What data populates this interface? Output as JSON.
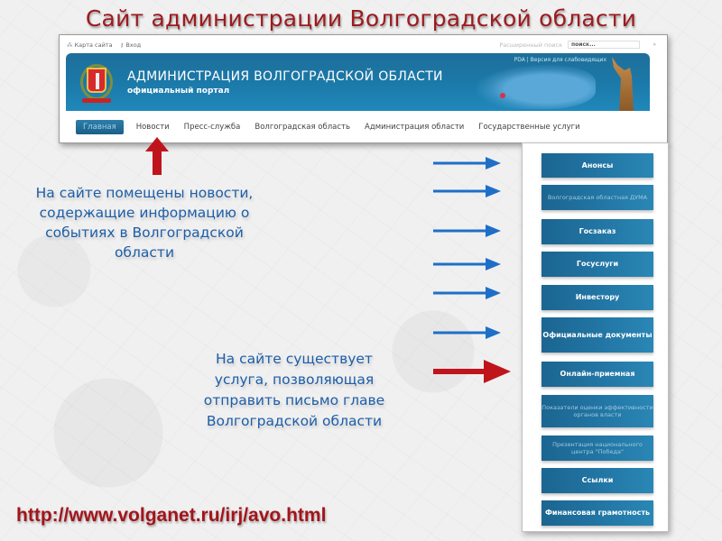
{
  "slide": {
    "title": "Сайт администрации Волгоградской области",
    "url": "http://www.volganet.ru/irj/avo.html"
  },
  "website": {
    "topbar": {
      "sitemap_link": "Карта сайта",
      "login_link": "Вход",
      "search_label": "Расширенный поиск",
      "search_placeholder": "поиск...",
      "search_go": "»"
    },
    "banner": {
      "title": "АДМИНИСТРАЦИЯ ВОЛГОГРАДСКОЙ ОБЛАСТИ",
      "subtitle": "официальный портал",
      "links": "PDA | Версия для слабовидящих"
    },
    "nav": [
      {
        "label": "Главная",
        "active": true
      },
      {
        "label": "Новости",
        "active": false
      },
      {
        "label": "Пресс-служба",
        "active": false
      },
      {
        "label": "Волгоградская область",
        "active": false
      },
      {
        "label": "Администрация области",
        "active": false
      },
      {
        "label": "Государственные услуги",
        "active": false
      }
    ]
  },
  "sidebar": {
    "buttons": [
      {
        "label": "Анонсы"
      },
      {
        "label": "Волгоградская областная ДУМА"
      },
      {
        "label": "Госзаказ"
      },
      {
        "label": "Госуслуги"
      },
      {
        "label": "Инвестору"
      },
      {
        "label": "Официальные документы"
      },
      {
        "label": "Онлайн-приемная"
      },
      {
        "label": "Показатели оценки эффективности органов власти"
      },
      {
        "label": "Презентация национального центра \"Победа\""
      },
      {
        "label": "Ссылки"
      },
      {
        "label": "Финансовая грамотность"
      }
    ]
  },
  "callouts": {
    "news": "На сайте помещены новости, содержащие информацию о событиях в Волгоградской области",
    "service": "На сайте существует услуга, позволяющая отправить письмо главе Волгоградской области"
  },
  "colors": {
    "title_red": "#9c1a1e",
    "callout_blue": "#1d5ea8",
    "arrow_blue": "#1e6fc8",
    "arrow_red": "#c0141c",
    "button_blue": "#1f6f9c"
  }
}
